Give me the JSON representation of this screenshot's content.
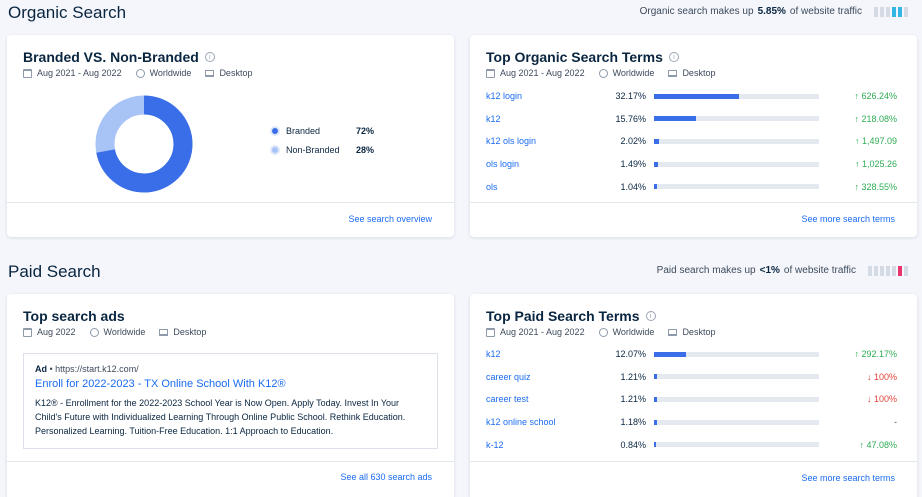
{
  "organic": {
    "section_title": "Organic Search",
    "traffic_prefix": "Organic search makes up",
    "traffic_value": "5.85%",
    "traffic_suffix": "of website traffic",
    "branded_card": {
      "title": "Branded VS. Non-Branded",
      "date_range": "Aug 2021 - Aug 2022",
      "region": "Worldwide",
      "device": "Desktop",
      "footer_link": "See search overview",
      "legend": [
        {
          "label": "Branded",
          "value": "72%",
          "color": "#3a6ee8"
        },
        {
          "label": "Non-Branded",
          "value": "28%",
          "color": "#a8c3f6"
        }
      ]
    },
    "terms_card": {
      "title": "Top Organic Search Terms",
      "date_range": "Aug 2021 - Aug 2022",
      "region": "Worldwide",
      "device": "Desktop",
      "footer_link": "See more search terms",
      "rows": [
        {
          "term": "k12 login",
          "share": "32.17%",
          "share_value": 32.17,
          "change": "626.24%",
          "dir": "up"
        },
        {
          "term": "k12",
          "share": "15.76%",
          "share_value": 15.76,
          "change": "218.08%",
          "dir": "up"
        },
        {
          "term": "k12 ols login",
          "share": "2.02%",
          "share_value": 2.02,
          "change": "1,497.09",
          "dir": "up"
        },
        {
          "term": "ols login",
          "share": "1.49%",
          "share_value": 1.49,
          "change": "1,025.26",
          "dir": "up"
        },
        {
          "term": "ols",
          "share": "1.04%",
          "share_value": 1.04,
          "change": "328.55%",
          "dir": "up"
        }
      ]
    }
  },
  "paid": {
    "section_title": "Paid Search",
    "traffic_prefix": "Paid search makes up",
    "traffic_value": "<1%",
    "traffic_suffix": "of website traffic",
    "ads_card": {
      "title": "Top search ads",
      "date": "Aug 2022",
      "region": "Worldwide",
      "device": "Desktop",
      "ad_label": "Ad",
      "ad_url": "https://start.k12.com/",
      "ad_headline": "Enroll for 2022-2023 - TX Online School With K12®",
      "ad_description": "K12® - Enrollment for the 2022-2023 School Year is Now Open. Apply Today. Invest In Your Child's Future with Individualized Learning Through Online Public School. Rethink Education. Personalized Learning. Tuition-Free Education. 1:1 Approach to Education.",
      "footer_link": "See all 630 search ads"
    },
    "terms_card": {
      "title": "Top Paid Search Terms",
      "date_range": "Aug 2021 - Aug 2022",
      "region": "Worldwide",
      "device": "Desktop",
      "footer_link": "See more search terms",
      "rows": [
        {
          "term": "k12",
          "share": "12.07%",
          "share_value": 12.07,
          "change": "292.17%",
          "dir": "up"
        },
        {
          "term": "career quiz",
          "share": "1.21%",
          "share_value": 1.21,
          "change": "100%",
          "dir": "down"
        },
        {
          "term": "career test",
          "share": "1.21%",
          "share_value": 1.21,
          "change": "100%",
          "dir": "down"
        },
        {
          "term": "k12 online school",
          "share": "1.18%",
          "share_value": 1.18,
          "change": "-",
          "dir": "flat"
        },
        {
          "term": "k-12",
          "share": "0.84%",
          "share_value": 0.84,
          "change": "47.08%",
          "dir": "up"
        }
      ]
    }
  },
  "colors": {
    "accent": "#1b6cf2",
    "bar": "#3a6ee8",
    "up": "#2eac54",
    "down": "#e2433a"
  }
}
